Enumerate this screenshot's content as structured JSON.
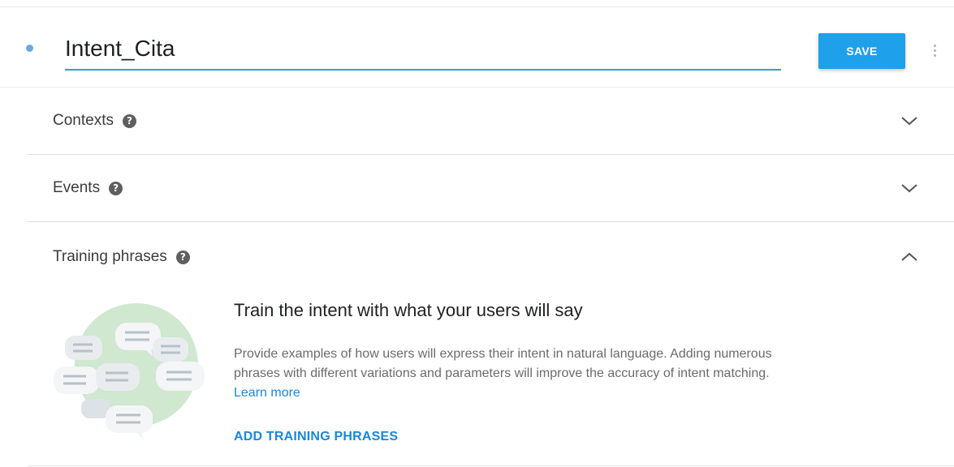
{
  "header": {
    "intent_name": "Intent_Cita",
    "save_label": "SAVE"
  },
  "sections": {
    "contexts": {
      "label": "Contexts",
      "expanded": false
    },
    "events": {
      "label": "Events",
      "expanded": false
    },
    "training": {
      "label": "Training phrases",
      "expanded": true
    }
  },
  "training_empty": {
    "title": "Train the intent with what your users will say",
    "desc_text": "Provide examples of how users will express their intent in natural language. Adding numerous phrases with different variations and parameters will improve the accuracy of intent matching.",
    "learn_more": "Learn more",
    "add_label": "ADD TRAINING PHRASES"
  },
  "icons": {
    "help": "help-circle-icon",
    "expand": "chevron-down-icon",
    "collapse": "chevron-up-icon",
    "more": "more-vert-icon"
  },
  "colors": {
    "accent": "#1ea0ea",
    "link": "#1a87d9",
    "illustration_circle": "#cfe8cf"
  }
}
